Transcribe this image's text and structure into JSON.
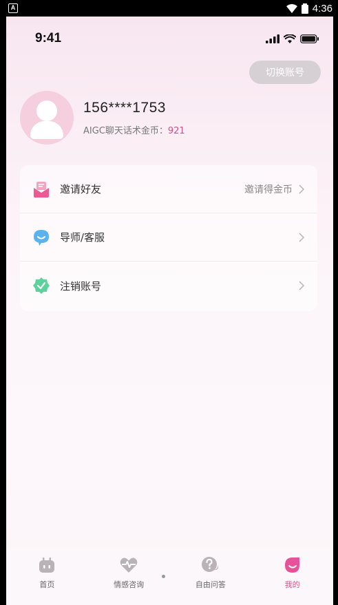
{
  "system_bar": {
    "time": "4:36",
    "notification_icon": "a-icon"
  },
  "app_status": {
    "time": "9:41"
  },
  "account": {
    "switch_label": "切换账号",
    "phone": "156****1753",
    "coins_label": "AIGC聊天话术金币：",
    "coins_value": "921"
  },
  "menu": {
    "items": [
      {
        "label": "邀请好友",
        "hint": "邀请得金币",
        "icon": "envelope-icon",
        "color": "#ea5a93"
      },
      {
        "label": "导师/客服",
        "hint": "",
        "icon": "chat-bubble-icon",
        "color": "#5ab3ef"
      },
      {
        "label": "注销账号",
        "hint": "",
        "icon": "shield-check-icon",
        "color": "#5fd29b"
      }
    ]
  },
  "tabbar": {
    "tabs": [
      {
        "label": "首页",
        "icon": "robot-icon",
        "active": false
      },
      {
        "label": "情感咨询",
        "icon": "heartbeat-icon",
        "active": false
      },
      {
        "label": "自由问答",
        "icon": "question-icon",
        "active": false
      },
      {
        "label": "我的",
        "icon": "profile-drop-icon",
        "active": true
      }
    ],
    "active_color": "#e24f8e",
    "inactive_color": "#999999"
  }
}
